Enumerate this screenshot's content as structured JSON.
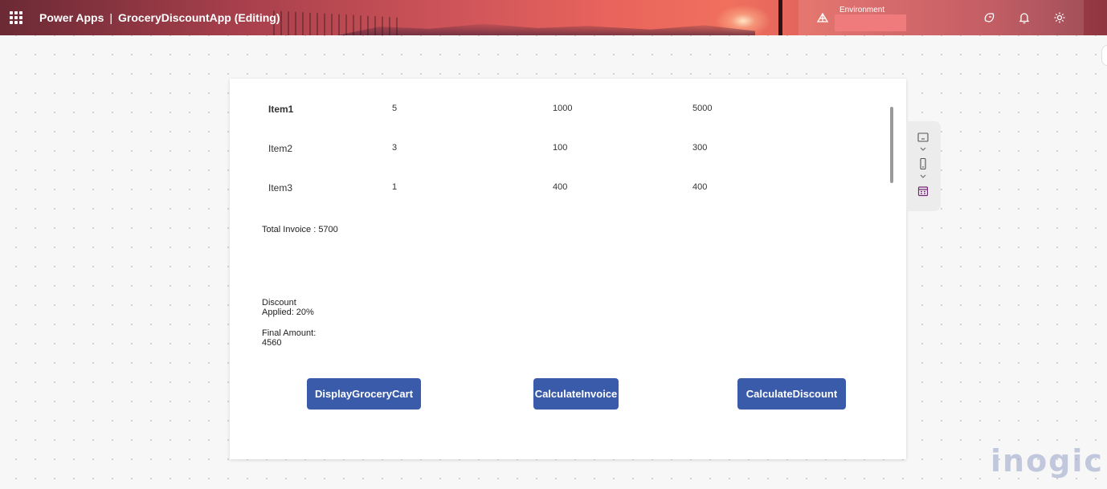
{
  "header": {
    "app_name": "Power Apps",
    "separator": "|",
    "document_title": "GroceryDiscountApp (Editing)",
    "environment_label": "Environment",
    "environment_value": ""
  },
  "grid_rows": [
    {
      "item": "Item1",
      "qty": "5",
      "price": "1000",
      "total": "5000"
    },
    {
      "item": "Item2",
      "qty": "3",
      "price": "100",
      "total": "300"
    },
    {
      "item": "Item3",
      "qty": "1",
      "price": "400",
      "total": "400"
    }
  ],
  "summary": {
    "total_invoice": "Total Invoice : 5700",
    "discount_line1": "Discount",
    "discount_line2": "Applied: 20%",
    "final_line1": "Final Amount:",
    "final_line2": "4560"
  },
  "buttons": {
    "display_cart": "DisplayGroceryCart",
    "calc_invoice": "CalculateInvoice",
    "calc_discount": "CalculateDiscount"
  },
  "watermark": "inogic",
  "colors": {
    "button_bg": "#3a5ba9",
    "header_accent": "#e8645c"
  }
}
